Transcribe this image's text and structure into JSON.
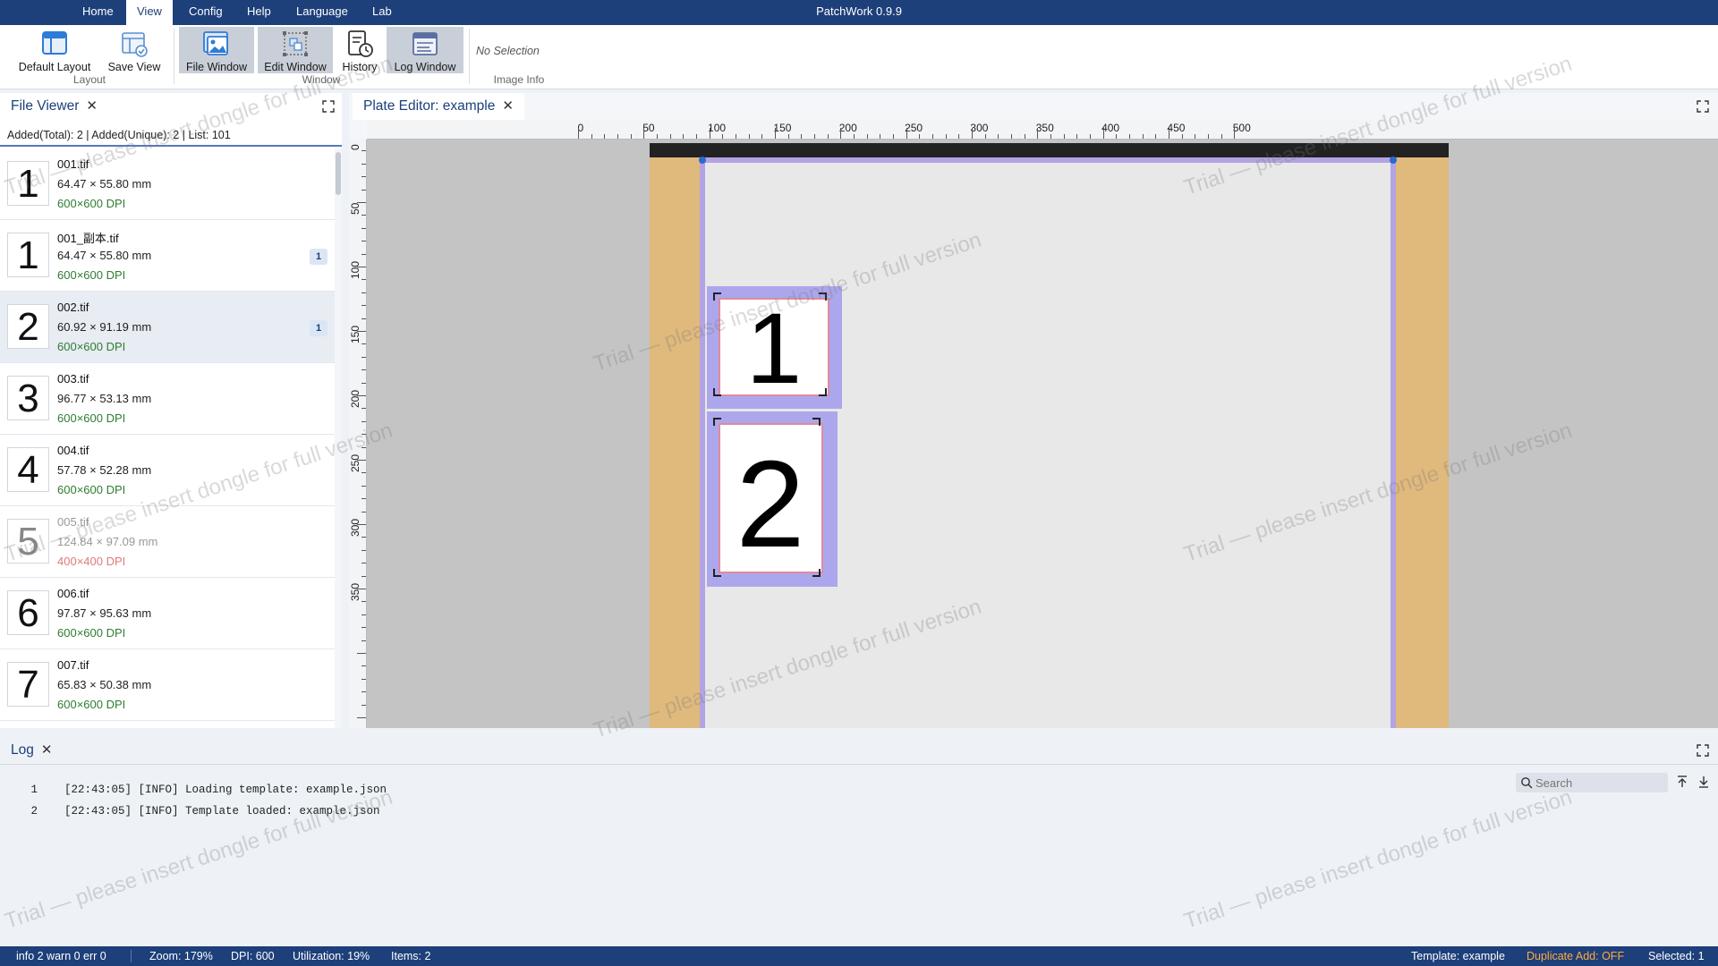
{
  "app": {
    "title": "PatchWork 0.9.9",
    "menu": [
      "Home",
      "View",
      "Config",
      "Help",
      "Language",
      "Lab"
    ],
    "active_menu": "View"
  },
  "ribbon": {
    "layout_group": {
      "label": "Layout",
      "buttons": [
        {
          "label": "Default Layout",
          "icon": "default-layout-icon"
        },
        {
          "label": "Save View",
          "icon": "save-view-icon"
        }
      ]
    },
    "window_group": {
      "label": "Window",
      "buttons": [
        {
          "label": "File Window",
          "icon": "file-window-icon",
          "pressed": true
        },
        {
          "label": "Edit Window",
          "icon": "edit-window-icon",
          "pressed": true
        },
        {
          "label": "History",
          "icon": "history-icon",
          "pressed": false
        },
        {
          "label": "Log Window",
          "icon": "log-window-icon",
          "pressed": true
        }
      ]
    },
    "image_info_group": {
      "label": "Image Info",
      "value": "No Selection"
    }
  },
  "file_viewer": {
    "tab_label": "File Viewer",
    "stats": "Added(Total): 2 | Added(Unique): 2 | List: 101",
    "files": [
      {
        "thumb": "1",
        "name": "001.tif",
        "dims": "64.47 × 55.80 mm",
        "dpi": "600×600 DPI",
        "badge": "",
        "selected": false,
        "dim": false
      },
      {
        "thumb": "1",
        "name": "001_副本.tif",
        "dims": "64.47 × 55.80 mm",
        "dpi": "600×600 DPI",
        "badge": "1",
        "selected": false,
        "dim": false
      },
      {
        "thumb": "2",
        "name": "002.tif",
        "dims": "60.92 × 91.19 mm",
        "dpi": "600×600 DPI",
        "badge": "1",
        "selected": true,
        "dim": false
      },
      {
        "thumb": "3",
        "name": "003.tif",
        "dims": "96.77 × 53.13 mm",
        "dpi": "600×600 DPI",
        "badge": "",
        "selected": false,
        "dim": false
      },
      {
        "thumb": "4",
        "name": "004.tif",
        "dims": "57.78 × 52.28 mm",
        "dpi": "600×600 DPI",
        "badge": "",
        "selected": false,
        "dim": false
      },
      {
        "thumb": "5",
        "name": "005.tif",
        "dims": "124.84 × 97.09 mm",
        "dpi": "400×400 DPI",
        "badge": "",
        "selected": false,
        "dim": true
      },
      {
        "thumb": "6",
        "name": "006.tif",
        "dims": "97.87 × 95.63 mm",
        "dpi": "600×600 DPI",
        "badge": "",
        "selected": false,
        "dim": false
      },
      {
        "thumb": "7",
        "name": "007.tif",
        "dims": "65.83 × 50.38 mm",
        "dpi": "600×600 DPI",
        "badge": "",
        "selected": false,
        "dim": false
      }
    ]
  },
  "plate_editor": {
    "tab_label": "Plate Editor: example",
    "ruler_x_labels": [
      "0",
      "50",
      "100",
      "150",
      "200",
      "250",
      "300",
      "350",
      "400",
      "450",
      "500"
    ],
    "ruler_y_labels": [
      "0",
      "50",
      "100",
      "150",
      "200",
      "250",
      "300",
      "350"
    ],
    "patches": [
      {
        "label": "1"
      },
      {
        "label": "2"
      }
    ]
  },
  "watermark": "Trial — please insert dongle for full version",
  "log": {
    "tab_label": "Log",
    "search_placeholder": "Search",
    "lines": [
      {
        "num": "1",
        "text": "[22:43:05] [INFO] Loading template: example.json"
      },
      {
        "num": "2",
        "text": "[22:43:05] [INFO] Template loaded: example.json"
      }
    ]
  },
  "status": {
    "counts": "info 2  warn 0  err 0",
    "zoom": "Zoom: 179%",
    "dpi": "DPI: 600",
    "utilization": "Utilization: 19%",
    "items": "Items: 2",
    "template": "Template: example",
    "duplicate_add": "Duplicate Add: OFF",
    "selected": "Selected: 1"
  },
  "colors": {
    "brand": "#1d3f7a",
    "accent_orange": "#ffab40",
    "margin_tan": "#e0b97d",
    "patch_frame": "#a9a3ea",
    "dpi_ok": "#2e7d32",
    "dpi_low": "#e07a7a"
  }
}
